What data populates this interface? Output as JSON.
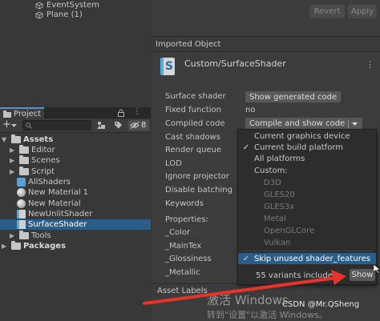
{
  "hierarchy": {
    "items": [
      {
        "label": "EventSystem"
      },
      {
        "label": "Plane (1)"
      }
    ]
  },
  "inspector": {
    "revert_label": "Revert",
    "apply_label": "Apply",
    "section_title": "Imported Object",
    "shader_icon_letter": "S",
    "shader_name": "Custom/SurfaceShader",
    "menu_glyph": "⋮",
    "rows": {
      "surface_shader_label": "Surface shader",
      "surface_shader_button": "Show generated code",
      "fixed_function_label": "Fixed function",
      "fixed_function_value": "no",
      "compiled_code_label": "Compiled code",
      "compiled_code_button": "Compile and show code",
      "cast_shadows_label": "Cast shadows",
      "render_queue_label": "Render queue",
      "lod_label": "LOD",
      "ignore_projector_label": "Ignore projector",
      "disable_batching_label": "Disable batching",
      "keywords_label": "Keywords",
      "properties_label": "Properties:",
      "color_label": "_Color",
      "maintex_label": "_MainTex",
      "glossiness_label": "_Glossiness",
      "metallic_label": "_Metallic"
    },
    "asset_labels": "Asset Labels"
  },
  "dropdown": {
    "items": [
      {
        "label": "Current graphics device",
        "checked": false,
        "disabled": false
      },
      {
        "label": "Current build platform",
        "checked": true,
        "disabled": false
      },
      {
        "label": "All platforms",
        "checked": false,
        "disabled": false
      },
      {
        "label": "Custom:",
        "checked": false,
        "disabled": false
      },
      {
        "label": "D3D",
        "checked": false,
        "disabled": true
      },
      {
        "label": "GLES20",
        "checked": false,
        "disabled": true
      },
      {
        "label": "GLES3x",
        "checked": false,
        "disabled": true
      },
      {
        "label": "Metal",
        "checked": false,
        "disabled": true
      },
      {
        "label": "OpenGLCore",
        "checked": false,
        "disabled": true
      },
      {
        "label": "Vulkan",
        "checked": false,
        "disabled": true
      }
    ],
    "skip_label": "Skip unused shader_features",
    "check_glyph": "✓",
    "variants_label": "55 variants included",
    "show_label": "Show"
  },
  "project": {
    "tab_label": "Project",
    "hidden_count": "8",
    "tree": [
      {
        "label": "Assets",
        "type": "folder",
        "expanded": true,
        "selected": false
      },
      {
        "label": "Editor",
        "type": "folder",
        "expanded": false,
        "selected": false
      },
      {
        "label": "Scenes",
        "type": "folder",
        "expanded": false,
        "selected": false
      },
      {
        "label": "Script",
        "type": "folder",
        "expanded": false,
        "selected": false
      },
      {
        "label": "AllShaders",
        "type": "shadervariants",
        "selected": false
      },
      {
        "label": "New Material 1",
        "type": "material",
        "selected": false
      },
      {
        "label": "New Material",
        "type": "material",
        "selected": false
      },
      {
        "label": "NewUnlitShader",
        "type": "shader",
        "selected": false
      },
      {
        "label": "SurfaceShader",
        "type": "shader",
        "selected": true
      },
      {
        "label": "Tools",
        "type": "folder",
        "expanded": false,
        "selected": false
      },
      {
        "label": "Packages",
        "type": "folder",
        "expanded": false,
        "selected": false
      }
    ]
  },
  "overlay": {
    "watermark_line1": "激活 Windows",
    "watermark_line2": "转到\"设置\"以激活 Windows。",
    "csdn_credit": "CSDN @Mr.QSheng"
  },
  "colors": {
    "selection": "#2c5d87",
    "annotation_arrow": "#e8332a"
  }
}
